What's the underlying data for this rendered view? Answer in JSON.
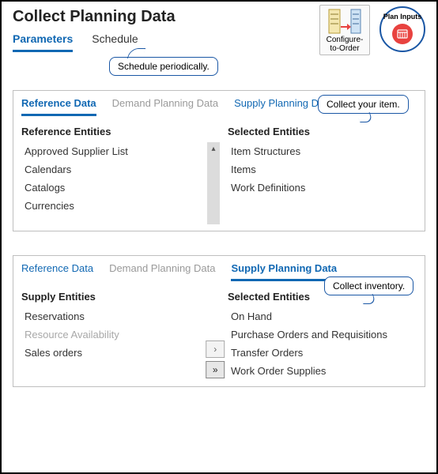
{
  "page_title": "Collect Planning Data",
  "top_tabs": {
    "parameters": "Parameters",
    "schedule": "Schedule"
  },
  "plan_inputs_label": "Plan Inputs",
  "cto_label": "Configure-to-Order",
  "callouts": {
    "schedule": "Schedule periodically.",
    "collect_item": "Collect your item.",
    "collect_inventory": "Collect inventory."
  },
  "panels": [
    {
      "tabs": {
        "ref": "Reference Data",
        "demand": "Demand Planning Data",
        "supply": "Supply Planning Data"
      },
      "active_tab": "ref",
      "left_heading": "Reference Entities",
      "right_heading": "Selected Entities",
      "reference_entities": [
        "Approved Supplier List",
        "Calendars",
        "Catalogs",
        "Currencies"
      ],
      "selected_entities": [
        "Item Structures",
        "Items",
        "Work Definitions"
      ]
    },
    {
      "tabs": {
        "ref": "Reference Data",
        "demand": "Demand Planning Data",
        "supply": "Supply Planning Data"
      },
      "active_tab": "supply",
      "left_heading": "Supply Entities",
      "right_heading": "Selected Entities",
      "supply_entities": [
        {
          "label": "Reservations",
          "dim": false
        },
        {
          "label": "Resource Availability",
          "dim": true
        },
        {
          "label": "Sales orders",
          "dim": false
        }
      ],
      "selected_entities": [
        "On Hand",
        "Purchase Orders and Requisitions",
        "Transfer Orders",
        "Work Order Supplies"
      ]
    }
  ],
  "mover": {
    "single": "›",
    "all": "»"
  }
}
